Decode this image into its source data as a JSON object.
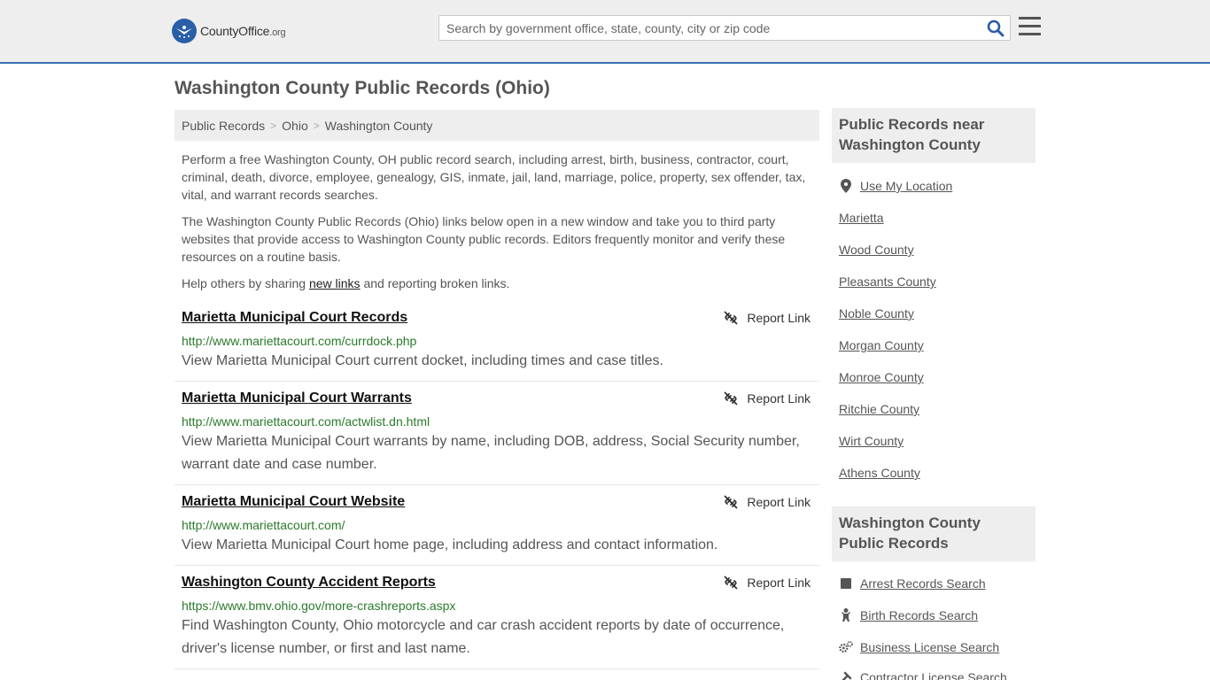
{
  "header": {
    "logo_main": "CountyOffice",
    "logo_suffix": ".org",
    "search_placeholder": "Search by government office, state, county, city or zip code"
  },
  "page_title": "Washington County Public Records (Ohio)",
  "breadcrumb": [
    "Public Records",
    "Ohio",
    "Washington County"
  ],
  "intro": {
    "p1": "Perform a free Washington County, OH public record search, including arrest, birth, business, contractor, court, criminal, death, divorce, employee, genealogy, GIS, inmate, jail, land, marriage, police, property, sex offender, tax, vital, and warrant records searches.",
    "p2": "The Washington County Public Records (Ohio) links below open in a new window and take you to third party websites that provide access to Washington County public records. Editors frequently monitor and verify these resources on a routine basis.",
    "p3_pre": "Help others by sharing ",
    "p3_link": "new links",
    "p3_post": " and reporting broken links."
  },
  "report_label": "Report Link",
  "records": [
    {
      "title": "Marietta Municipal Court Records",
      "url": "http://www.mariettacourt.com/currdock.php",
      "desc": "View Marietta Municipal Court current docket, including times and case titles."
    },
    {
      "title": "Marietta Municipal Court Warrants",
      "url": "http://www.mariettacourt.com/actwlist.dn.html",
      "desc": "View Marietta Municipal Court warrants by name, including DOB, address, Social Security number, warrant date and case number."
    },
    {
      "title": "Marietta Municipal Court Website",
      "url": "http://www.mariettacourt.com/",
      "desc": "View Marietta Municipal Court home page, including address and contact information."
    },
    {
      "title": "Washington County Accident Reports",
      "url": "https://www.bmv.ohio.gov/more-crashreports.aspx",
      "desc": "Find Washington County, Ohio motorcycle and car crash accident reports by date of occurrence, driver's license number, or first and last name."
    }
  ],
  "sidebar": {
    "near_heading": "Public Records near Washington County",
    "use_location": "Use My Location",
    "near_links": [
      "Marietta",
      "Wood County",
      "Pleasants County",
      "Noble County",
      "Morgan County",
      "Monroe County",
      "Ritchie County",
      "Wirt County",
      "Athens County"
    ],
    "records_heading": "Washington County Public Records",
    "record_links": [
      {
        "label": "Arrest Records Search",
        "icon": "square-icon"
      },
      {
        "label": "Birth Records Search",
        "icon": "baby-icon"
      },
      {
        "label": "Business License Search",
        "icon": "gears-icon"
      },
      {
        "label": "Contractor License Search",
        "icon": "tools-icon"
      }
    ]
  }
}
